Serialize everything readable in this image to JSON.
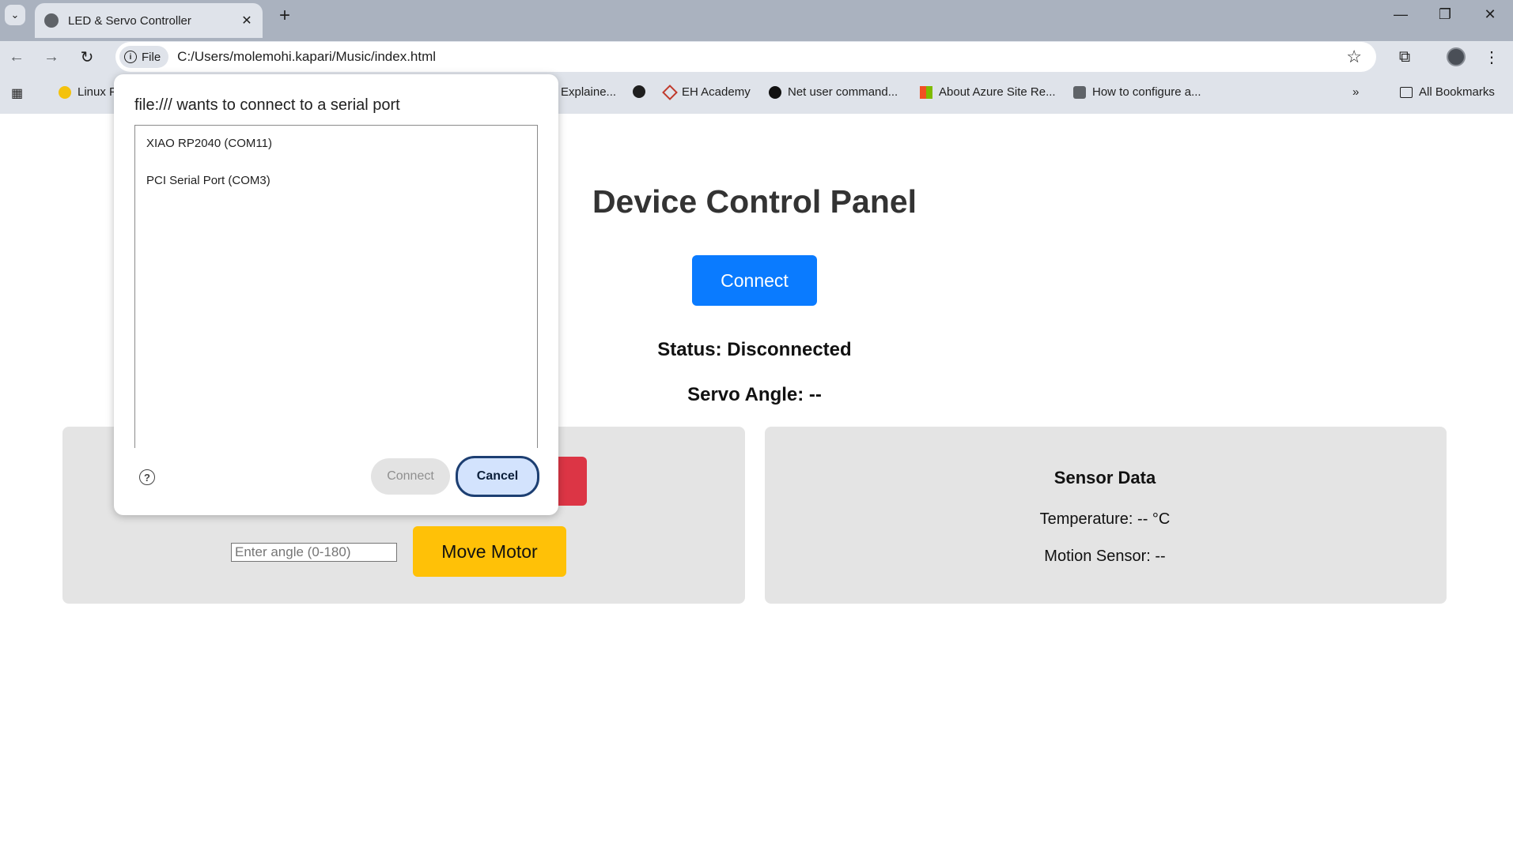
{
  "browser": {
    "tab_title": "LED & Servo Controller",
    "address_chip": "File",
    "url": "C:/Users/molemohi.kapari/Music/index.html",
    "bookmarks": [
      {
        "label": "Linux F",
        "icon": "linux-icon"
      },
      {
        "label": "Explaine...",
        "icon": "page-icon"
      },
      {
        "label": "",
        "icon": "globe-icon"
      },
      {
        "label": "EH Academy",
        "icon": "eh-academy-icon"
      },
      {
        "label": "Net user command...",
        "icon": "dot-icon"
      },
      {
        "label": "About Azure Site Re...",
        "icon": "microsoft-icon"
      },
      {
        "label": "How to configure a...",
        "icon": "page-icon"
      }
    ],
    "all_bookmarks_label": "All Bookmarks",
    "colors": {
      "tabstrip": "#aab2bf",
      "toolbar": "#dfe3ea"
    }
  },
  "page": {
    "heading": "Device Control Panel",
    "connect_label": "Connect",
    "status_text": "Status: Disconnected",
    "servo_text": "Servo Angle: --",
    "angle_placeholder": "Enter angle (0-180)",
    "move_motor_label": "Move Motor",
    "sensor": {
      "title": "Sensor Data",
      "temperature": "Temperature: -- °C",
      "motion": "Motion Sensor: --"
    },
    "colors": {
      "connect": "#0a7bff",
      "led_off": "#dc3545",
      "move": "#ffc107",
      "panel": "#e4e4e4"
    }
  },
  "dialog": {
    "title": "file:/// wants to connect to a serial port",
    "ports": [
      "XIAO RP2040 (COM11)",
      "PCI Serial Port (COM3)"
    ],
    "connect_label": "Connect",
    "cancel_label": "Cancel",
    "help_icon": "help-icon"
  }
}
